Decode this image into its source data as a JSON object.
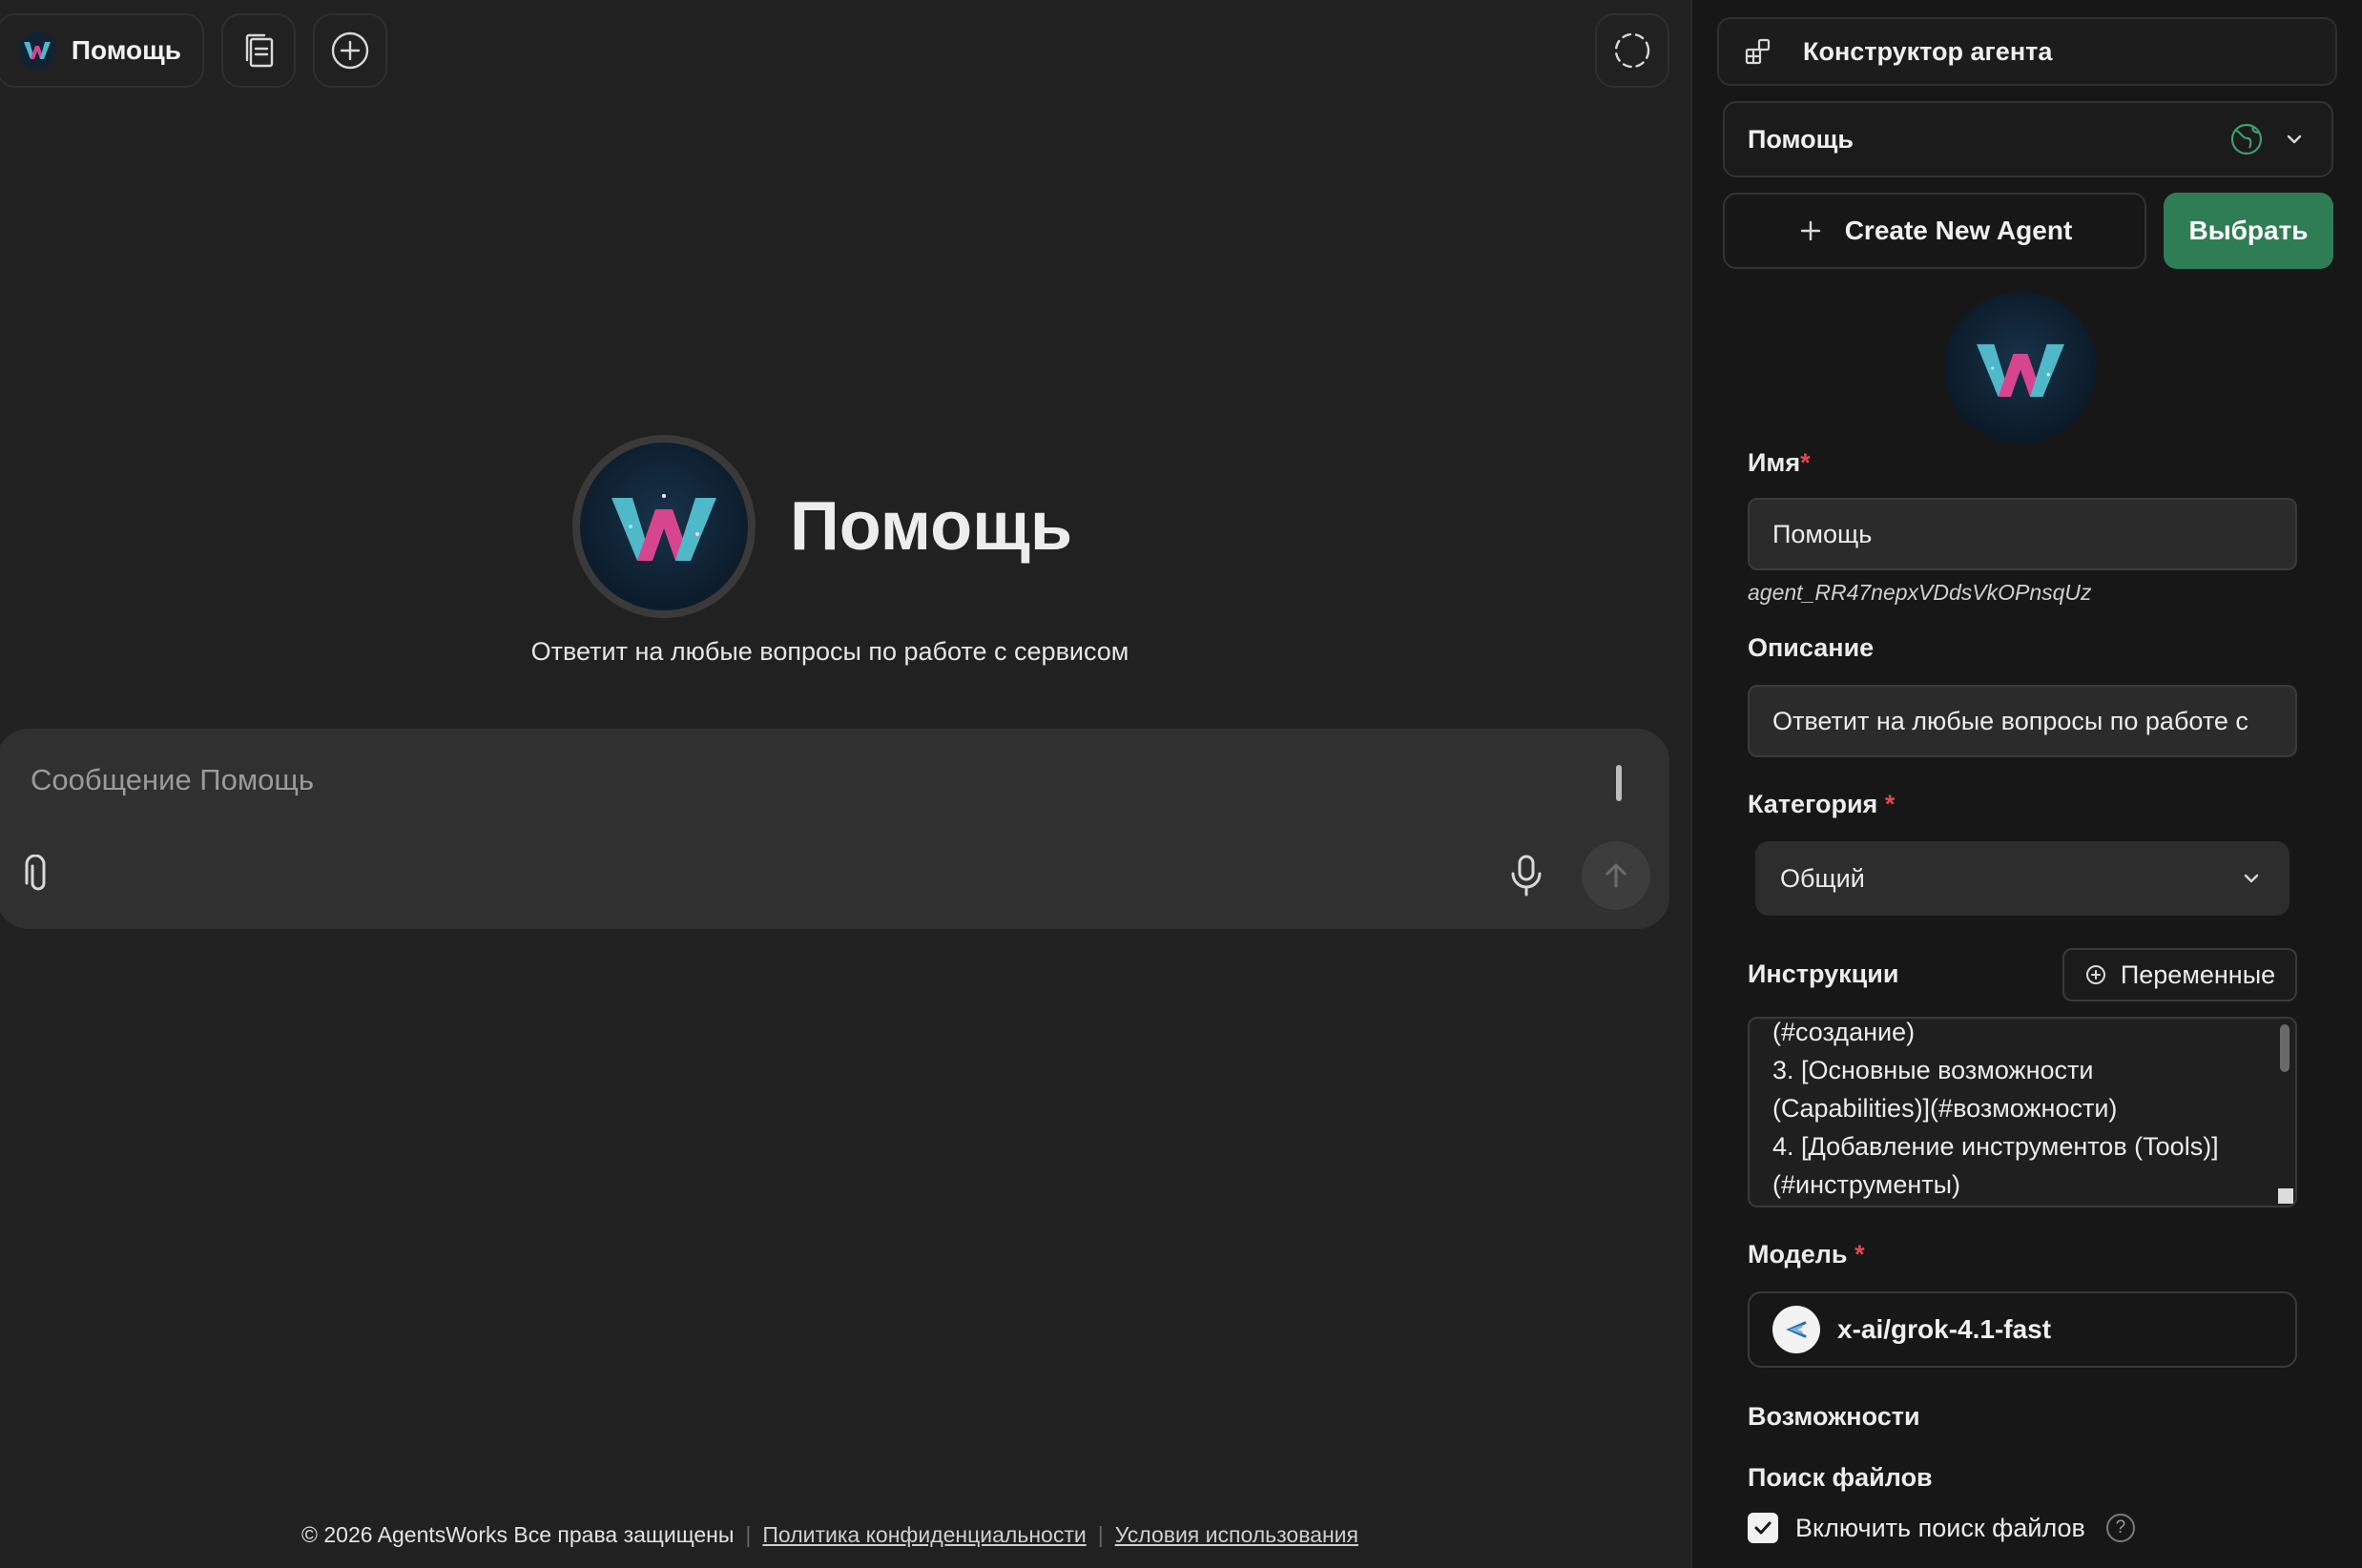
{
  "main": {
    "agent_pill": {
      "name": "Помощь"
    },
    "hero": {
      "title": "Помощь",
      "description": "Ответит на любые вопросы по работе с сервисом"
    },
    "composer": {
      "placeholder": "Сообщение Помощь"
    },
    "footer": {
      "copyright": "© 2026 AgentsWorks Все права защищены",
      "privacy": "Политика конфиденциальности",
      "terms": "Условия использования"
    }
  },
  "panel": {
    "header_title": "Конструктор агента",
    "agent_select": {
      "value": "Помощь"
    },
    "create_button": "Create New Agent",
    "choose_button": "Выбрать",
    "name": {
      "label": "Имя",
      "required": "*",
      "value": "Помощь"
    },
    "agent_id": "agent_RR47nepxVDdsVkOPnsqUz",
    "description": {
      "label": "Описание",
      "value": "Ответит на любые вопросы по работе с"
    },
    "category": {
      "label": "Категория",
      "required": "*",
      "value": "Общий"
    },
    "instructions": {
      "label": "Инструкции",
      "variables_button": "Переменные",
      "lines": [
        "(#создание)",
        "3.  [Основные возможности",
        "(Capabilities)](#возможности)",
        "4.  [Добавление инструментов (Tools)]",
        "(#инструменты)"
      ]
    },
    "model": {
      "label": "Модель",
      "required": "*",
      "value": "x-ai/grok-4.1-fast"
    },
    "capabilities_label": "Возможности",
    "file_search": {
      "label": "Поиск файлов",
      "checkbox_label": "Включить поиск файлов",
      "checked": true,
      "help": "?"
    }
  },
  "colors": {
    "background": "#212121",
    "panel": "#171717",
    "accent_green": "#2f7d55",
    "required": "#e24a4a"
  }
}
